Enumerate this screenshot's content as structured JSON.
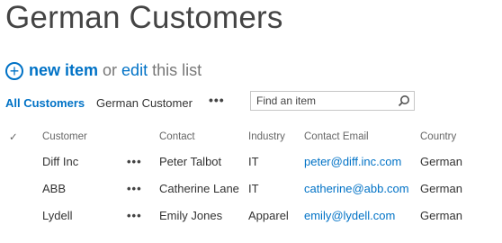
{
  "page": {
    "title": "German Customers"
  },
  "actions": {
    "new_item": "new item",
    "or_text": "or",
    "edit": "edit",
    "list_text": "this list"
  },
  "views": {
    "all": "All Customers",
    "german": "German Customer",
    "more": "•••"
  },
  "search": {
    "placeholder": "Find an item"
  },
  "table": {
    "headers": {
      "check": "✓",
      "customer": "Customer",
      "contact": "Contact",
      "industry": "Industry",
      "email": "Contact Email",
      "country": "Country"
    },
    "row_menu": "•••",
    "rows": [
      {
        "customer": "Diff Inc",
        "contact": "Peter Talbot",
        "industry": "IT",
        "email": "peter@diff.inc.com",
        "country": "German"
      },
      {
        "customer": "ABB",
        "contact": "Catherine Lane",
        "industry": "IT",
        "email": "catherine@abb.com",
        "country": "German"
      },
      {
        "customer": "Lydell",
        "contact": "Emily Jones",
        "industry": "Apparel",
        "email": "emily@lydell.com",
        "country": "German"
      }
    ]
  },
  "colors": {
    "accent": "#0072c6",
    "text": "#333333",
    "muted": "#777777"
  },
  "icons": {
    "add": "plus-circle-icon",
    "search": "search-icon",
    "check": "checkmark-icon",
    "more": "ellipsis-icon"
  }
}
